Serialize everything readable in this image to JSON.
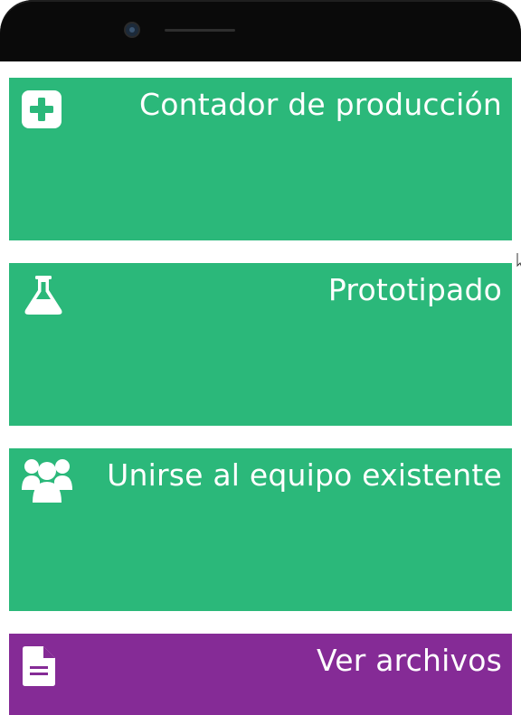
{
  "colors": {
    "tile_green": "#2bb87a",
    "tile_purple": "#852b96",
    "text": "#ffffff",
    "background": "#ffffff"
  },
  "tiles": [
    {
      "label": "Contador de producción",
      "icon": "plus-square-icon",
      "color": "#2bb87a"
    },
    {
      "label": "Prototipado",
      "icon": "flask-icon",
      "color": "#2bb87a"
    },
    {
      "label": "Unirse al equipo existente",
      "icon": "users-icon",
      "color": "#2bb87a"
    },
    {
      "label": "Ver archivos",
      "icon": "file-text-icon",
      "color": "#852b96"
    }
  ]
}
